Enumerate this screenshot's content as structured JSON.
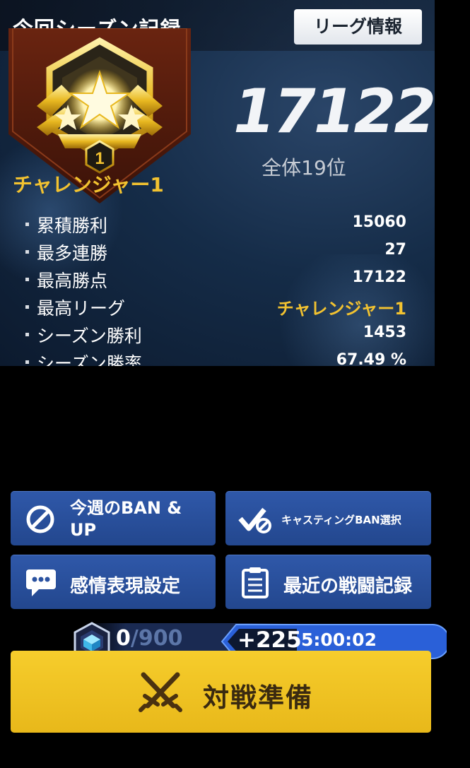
{
  "header": {
    "title": "今回シーズン記録",
    "league_button": "リーグ情報"
  },
  "rank": {
    "name": "チャレンジャー1",
    "tier_number": "1",
    "score": "17122",
    "position": "全体19位"
  },
  "stats": [
    {
      "label": "累積勝利",
      "value": "15060"
    },
    {
      "label": "最多連勝",
      "value": "27"
    },
    {
      "label": "最高勝点",
      "value": "17122"
    },
    {
      "label": "最高リーグ",
      "value": "チャレンジャー1"
    },
    {
      "label": "シーズン勝利",
      "value": "1453"
    },
    {
      "label": "シーズン勝率",
      "value": "67.49 %"
    }
  ],
  "menu": {
    "ban_up": "今週のBAN &\nUP",
    "casting_ban": "キャスティングBAN選択",
    "emotes": "感情表現設定",
    "battle_log": "最近の戦闘記録"
  },
  "reward": {
    "current": "0",
    "max": "/900",
    "bonus": "+225",
    "timer": "5:00:02"
  },
  "battle": {
    "label": "対戦準備"
  },
  "colors": {
    "gold": "#f2c230",
    "button_blue": "#2a52a0",
    "battle_yellow": "#f2c427"
  },
  "icons": [
    "ban-icon",
    "checkmark-ban-icon",
    "chat-bubble-icon",
    "clipboard-icon",
    "gem-icon",
    "crossed-swords-icon"
  ]
}
